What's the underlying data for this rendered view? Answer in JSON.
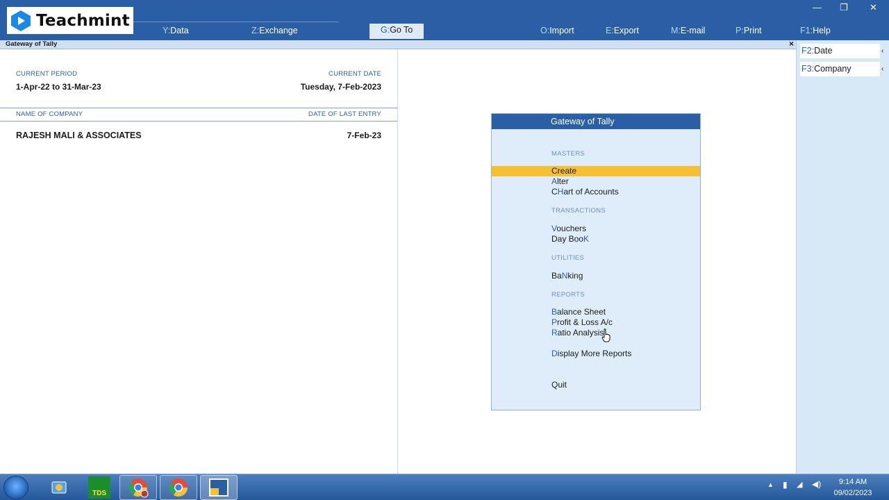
{
  "branding": {
    "name": "Teachmint"
  },
  "menu": [
    {
      "key": "Y:",
      "label": "Data"
    },
    {
      "key": "Z:",
      "label": "Exchange"
    },
    {
      "key": "G:",
      "label": "Go To"
    },
    {
      "key": "O:",
      "label": "Import"
    },
    {
      "key": "E:",
      "label": "Export"
    },
    {
      "key": "M:",
      "label": "E-mail"
    },
    {
      "key": "P:",
      "label": "Print"
    },
    {
      "key": "F1:",
      "label": "Help"
    }
  ],
  "title_bar": {
    "title": "Gateway of Tally",
    "close": "×"
  },
  "period": {
    "current_period_label": "CURRENT PERIOD",
    "current_period_value": "1-Apr-22 to 31-Mar-23",
    "current_date_label": "CURRENT DATE",
    "current_date_value": "Tuesday, 7-Feb-2023"
  },
  "company": {
    "name_label": "NAME OF COMPANY",
    "last_entry_label": "DATE OF LAST ENTRY",
    "name": "RAJESH MALI & ASSOCIATES",
    "last_entry": "7-Feb-23"
  },
  "gateway": {
    "title": "Gateway of Tally",
    "sections": {
      "masters": "MASTERS",
      "transactions": "TRANSACTIONS",
      "utilities": "UTILITIES",
      "reports": "REPORTS"
    },
    "items": {
      "create": {
        "pre": "",
        "key": "",
        "post": "Create"
      },
      "alter": {
        "pre": "",
        "key": "A",
        "post": "lter"
      },
      "chart": {
        "pre": "C",
        "key": "H",
        "post": "art of Accounts"
      },
      "vouchers": {
        "pre": "",
        "key": "V",
        "post": "ouchers"
      },
      "daybook": {
        "pre": "Day Boo",
        "key": "K",
        "post": ""
      },
      "banking": {
        "pre": "Ba",
        "key": "N",
        "post": "king"
      },
      "balance": {
        "pre": "",
        "key": "B",
        "post": "alance Sheet"
      },
      "pnl": {
        "pre": "",
        "key": "P",
        "post": "rofit & Loss A/c"
      },
      "ratio": {
        "pre": "",
        "key": "R",
        "post": "atio Analysis"
      },
      "more": {
        "pre": "",
        "key": "D",
        "post": "isplay More Reports"
      },
      "quit": {
        "pre": "",
        "key": "",
        "post": "Quit"
      }
    }
  },
  "side_buttons": [
    {
      "key": "F2:",
      "label": "Date"
    },
    {
      "key": "F3:",
      "label": "Company"
    }
  ],
  "taskbar": {
    "apps": [
      "Internet Explorer",
      "Saral TDS",
      "Chrome Profile R",
      "Chrome",
      "Tally"
    ],
    "time": "9:14 AM",
    "date": "09/02/2023",
    "saral_text": "TDS"
  },
  "colors": {
    "topbar": "#2a5fa6",
    "highlight": "#f6c033",
    "panel": "#deedf9"
  }
}
